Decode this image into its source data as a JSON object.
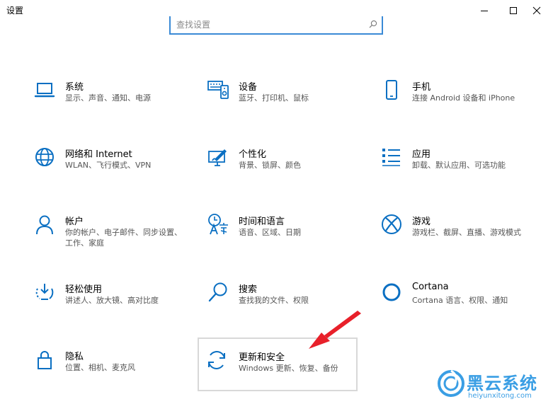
{
  "window": {
    "title": "设置"
  },
  "search": {
    "placeholder": "查找设置"
  },
  "colors": {
    "accent": "#0a6fc2",
    "arrow": "#e8202a",
    "watermark": "#3a9ee4"
  },
  "tiles": [
    {
      "name": "系统",
      "desc": "显示、声音、通知、电源",
      "icon": "laptop-icon"
    },
    {
      "name": "设备",
      "desc": "蓝牙、打印机、鼠标",
      "icon": "devices-icon"
    },
    {
      "name": "手机",
      "desc": "连接 Android 设备和 iPhone",
      "icon": "phone-icon"
    },
    {
      "name": "网络和 Internet",
      "desc": "WLAN、飞行模式、VPN",
      "icon": "globe-icon"
    },
    {
      "name": "个性化",
      "desc": "背景、锁屏、颜色",
      "icon": "personalization-icon"
    },
    {
      "name": "应用",
      "desc": "卸载、默认应用、可选功能",
      "icon": "apps-list-icon"
    },
    {
      "name": "帐户",
      "desc": "你的帐户、电子邮件、同步设置、工作、家庭",
      "icon": "person-icon"
    },
    {
      "name": "时间和语言",
      "desc": "语音、区域、日期",
      "icon": "time-language-icon"
    },
    {
      "name": "游戏",
      "desc": "游戏栏、截屏、直播、游戏模式",
      "icon": "xbox-icon"
    },
    {
      "name": "轻松使用",
      "desc": "讲述人、放大镜、高对比度",
      "icon": "ease-of-access-icon"
    },
    {
      "name": "搜索",
      "desc": "查找我的文件、权限",
      "icon": "search-magnifier-icon"
    },
    {
      "name": "Cortana",
      "desc": "Cortana 语言、权限、通知",
      "icon": "cortana-ring-icon"
    },
    {
      "name": "隐私",
      "desc": "位置、相机、麦克风",
      "icon": "lock-icon"
    },
    {
      "name": "更新和安全",
      "desc": "Windows 更新、恢复、备份",
      "icon": "update-sync-icon"
    }
  ],
  "watermark": {
    "brand": "黑云系统",
    "url": "heiyunxitong.com"
  }
}
